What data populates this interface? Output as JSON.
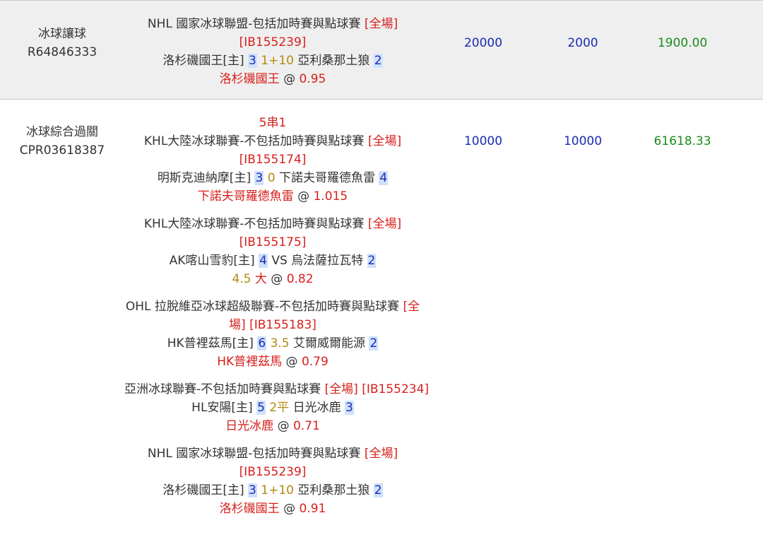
{
  "rows": [
    {
      "type_name": "冰球讓球",
      "ticket_id": "R64846333",
      "stake": "20000",
      "valid": "2000",
      "win": "1900.00",
      "legs": [
        {
          "league": "NHL 國家冰球聯盟-包括加時賽與點球賽",
          "period": "[全場]",
          "event_code": "[IB155239]",
          "home": "洛杉磯國王[主]",
          "home_score": "3",
          "handicap": "1+10",
          "away": "亞利桑那土狼",
          "away_score": "2",
          "pick": "洛杉磯國王",
          "at": "@",
          "odds": "0.95"
        }
      ]
    },
    {
      "type_name": "冰球綜合過關",
      "ticket_id": "CPR03618387",
      "parlay": "5串1",
      "stake": "10000",
      "valid": "10000",
      "win": "61618.33",
      "legs": [
        {
          "league": "KHL大陸冰球聯賽-不包括加時賽與點球賽",
          "period": "[全場]",
          "event_code": "[IB155174]",
          "home": "明斯克迪納摩[主]",
          "home_score": "3",
          "handicap": "0",
          "away": "下諾夫哥羅德魚雷",
          "away_score": "4",
          "pick": "下諾夫哥羅德魚雷",
          "at": "@",
          "odds": "1.015"
        },
        {
          "league": "KHL大陸冰球聯賽-不包括加時賽與點球賽",
          "period": "[全場]",
          "event_code": "[IB155175]",
          "home": "AK喀山雪豹[主]",
          "home_score": "4",
          "handicap": "VS",
          "away": "烏法薩拉瓦特",
          "away_score": "2",
          "pick_line": "4.5",
          "pick": "大",
          "at": "@",
          "odds": "0.82"
        },
        {
          "league_a": "OHL 拉脫維亞冰球超級聯賽-不包括加時賽與點球賽",
          "period_a": "[全",
          "period_b": "場]",
          "event_code": "[IB155183]",
          "home": "HK普裡茲馬[主]",
          "home_score": "6",
          "handicap": "3.5",
          "away": "艾爾威爾能源",
          "away_score": "2",
          "pick": "HK普裡茲馬",
          "at": "@",
          "odds": "0.79"
        },
        {
          "league": "亞洲冰球聯賽-不包括加時賽與點球賽",
          "period": "[全場]",
          "event_code": "[IB155234]",
          "home": "HL安陽[主]",
          "home_score": "5",
          "handicap": "2平",
          "away": "日光冰鹿",
          "away_score": "3",
          "pick": "日光冰鹿",
          "at": "@",
          "odds": "0.71"
        },
        {
          "league": "NHL 國家冰球聯盟-包括加時賽與點球賽",
          "period": "[全場]",
          "event_code": "[IB155239]",
          "home": "洛杉磯國王[主]",
          "home_score": "3",
          "handicap": "1+10",
          "away": "亞利桑那土狼",
          "away_score": "2",
          "pick": "洛杉磯國王",
          "at": "@",
          "odds": "0.91"
        }
      ]
    }
  ],
  "colors": {
    "row_shade": "#efefef",
    "red": "#d7201c",
    "blue": "#1a2bb5",
    "green": "#1b8a1b",
    "gold": "#b58a10",
    "score_highlight": "#cfe1fb"
  }
}
